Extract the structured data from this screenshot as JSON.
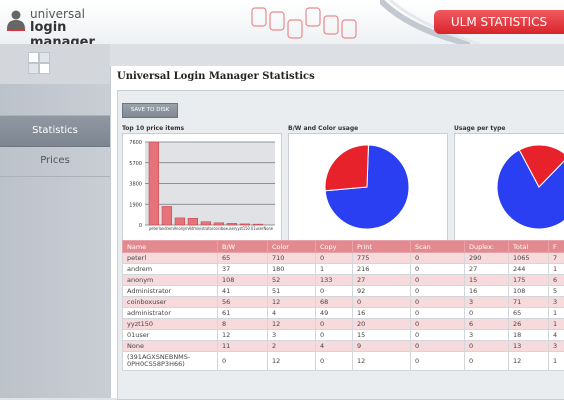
{
  "logo": {
    "line1": "universal",
    "line2": "login manager"
  },
  "header": {
    "tab_label": "ULM STATISTICS"
  },
  "sidebar": {
    "items": [
      {
        "label": "Statistics",
        "active": true
      },
      {
        "label": "Prices",
        "active": false
      }
    ]
  },
  "page": {
    "title": "Universal Login Manager Statistics",
    "save_label": "SAVE TO DISK"
  },
  "panels": {
    "top10_title": "Top 10 price items",
    "bw_title": "B/W and Color usage",
    "type_title": "Usage per type"
  },
  "colors": {
    "accent": "#e23036",
    "bar": "#e57379",
    "pie_blue": "#2a3ff2",
    "pie_red": "#e8222b",
    "table_header": "#e28a8f"
  },
  "table": {
    "columns": [
      "Name",
      "B/W",
      "Color",
      "Copy",
      "Print",
      "Scan",
      "Duplex:",
      "Total",
      "F"
    ],
    "rows": [
      [
        "peterl",
        "65",
        "710",
        "0",
        "775",
        "0",
        "290",
        "1065",
        "7"
      ],
      [
        "andrem",
        "37",
        "180",
        "1",
        "216",
        "0",
        "27",
        "244",
        "1"
      ],
      [
        "anonym",
        "108",
        "52",
        "133",
        "27",
        "0",
        "15",
        "175",
        "6"
      ],
      [
        "Administrator",
        "41",
        "51",
        "0",
        "92",
        "0",
        "16",
        "108",
        "5"
      ],
      [
        "coinboxuser",
        "56",
        "12",
        "68",
        "0",
        "0",
        "3",
        "71",
        "3"
      ],
      [
        "administrator",
        "61",
        "4",
        "49",
        "16",
        "0",
        "0",
        "65",
        "1"
      ],
      [
        "yyzt150",
        "8",
        "12",
        "0",
        "20",
        "0",
        "6",
        "26",
        "1"
      ],
      [
        "01user",
        "12",
        "3",
        "0",
        "15",
        "0",
        "3",
        "18",
        "4"
      ],
      [
        "None",
        "11",
        "2",
        "4",
        "9",
        "0",
        "0",
        "13",
        "3"
      ],
      [
        "(391AGXSNEBNMS-0PH0CS58P3H66)",
        "0",
        "12",
        "0",
        "12",
        "0",
        "0",
        "12",
        "1"
      ]
    ]
  },
  "chart_data": [
    {
      "type": "bar",
      "title": "Top 10 price items",
      "categories": [
        "peterl",
        "andrem",
        "anonym",
        "Administrator",
        "coinboxuser",
        "administrator",
        "yyzt150",
        "01user",
        "None"
      ],
      "category_label_text": "peterlandremAnonymAdministratorcoinboxuseryyzt150 01userNone",
      "values": [
        7600,
        1700,
        650,
        620,
        300,
        200,
        150,
        100,
        80
      ],
      "yticks": [
        "7600",
        "5700",
        "3800",
        "1900",
        "0"
      ],
      "ylim": [
        0,
        7600
      ]
    },
    {
      "type": "pie",
      "title": "B/W and Color usage",
      "slices": [
        {
          "label": "B/W",
          "value": 73,
          "color": "#2a3ff2"
        },
        {
          "label": "Color",
          "value": 27,
          "color": "#e8222b"
        }
      ]
    },
    {
      "type": "pie",
      "title": "Usage per type",
      "slices": [
        {
          "label": "Print",
          "value": 80,
          "color": "#2a3ff2"
        },
        {
          "label": "Copy",
          "value": 20,
          "color": "#e8222b"
        }
      ]
    }
  ]
}
